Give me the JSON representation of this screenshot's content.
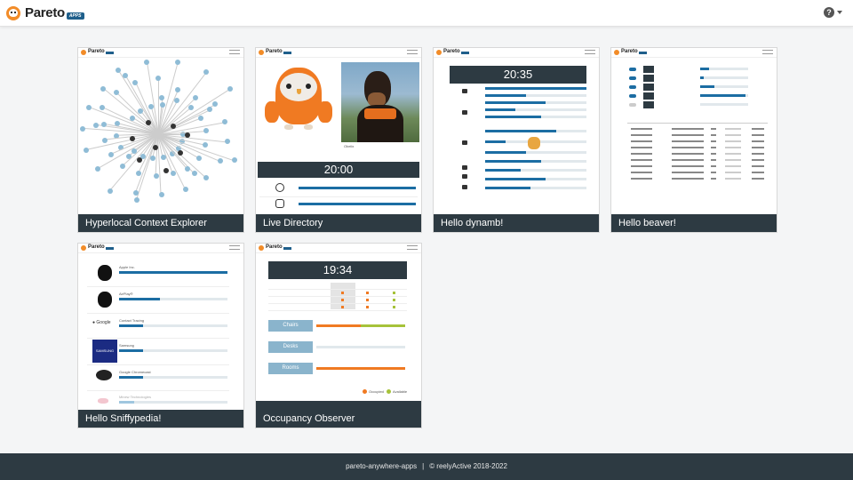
{
  "header": {
    "brand_name": "Pareto",
    "brand_badge": "APPS",
    "help_label": "?"
  },
  "cards": [
    {
      "title": "Hyperlocal Context Explorer"
    },
    {
      "title": "Live Directory",
      "clock": "20:00",
      "caption": "Obelix"
    },
    {
      "title": "Hello dynamb!",
      "clock": "20:35"
    },
    {
      "title": "Hello beaver!"
    },
    {
      "title": "Hello Sniffypedia!",
      "items": [
        "Apple Inc.",
        "AirPlay®",
        "Contact Tracing",
        "Samsung",
        "Google Chromecast",
        "Minew Technologies"
      ]
    },
    {
      "title": "Occupancy Observer",
      "clock": "19:34",
      "rooms": [
        "Chairs",
        "Desks",
        "Rooms"
      ],
      "legend": [
        "Occupied",
        "Available"
      ]
    }
  ],
  "footer": {
    "left": "pareto-anywhere-apps",
    "separator": "|",
    "right": "© reelyActive 2018-2022"
  },
  "colors": {
    "accent": "#1c6da3",
    "dark": "#2d3a42",
    "orange": "#f28c28",
    "green": "#a6c23a"
  }
}
